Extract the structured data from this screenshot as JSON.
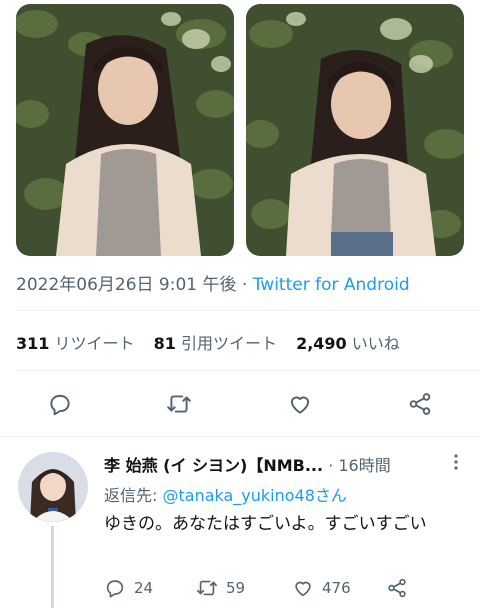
{
  "tweet": {
    "timestamp": "2022年06月26日 9:01 午後",
    "separator": "·",
    "source": "Twitter for Android",
    "stats": [
      {
        "count": "311",
        "label": "リツイート"
      },
      {
        "count": "81",
        "label": "引用ツイート"
      },
      {
        "count": "2,490",
        "label": "いいね"
      }
    ]
  },
  "reply": {
    "display_name": "李 始燕 (イ シヨン)【NMB...",
    "time": "· 16時間",
    "reply_to_label": "返信先: ",
    "reply_to_handle": "@tanaka_yukino48さん",
    "text": "ゆきの。あなたはすごいよ。すごいすごい",
    "reply_count": "24",
    "retweet_count": "59",
    "like_count": "476"
  },
  "colors": {
    "accent": "#1d9bf0",
    "secondary_text": "#536471",
    "primary_text": "#0f1419"
  },
  "icons": [
    "reply-icon",
    "retweet-icon",
    "like-icon",
    "share-icon",
    "more-icon"
  ]
}
